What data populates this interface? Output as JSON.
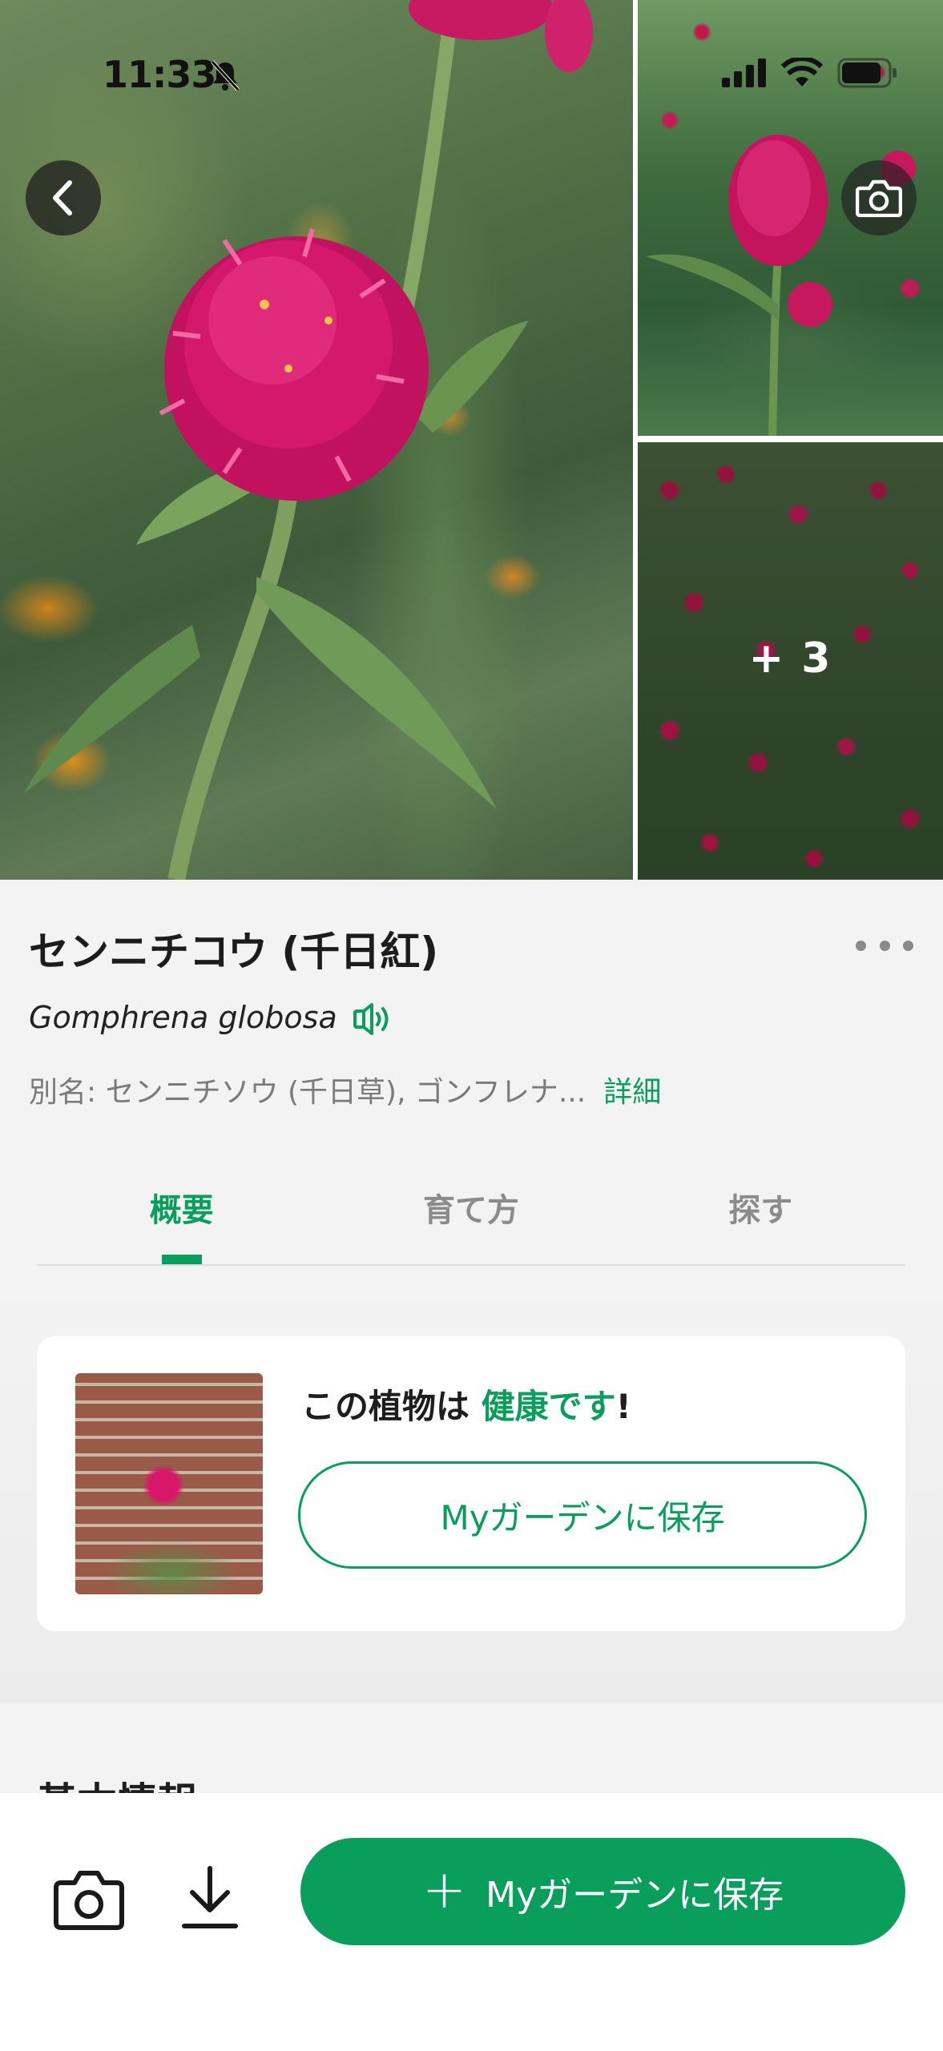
{
  "status_bar": {
    "time": "11:33",
    "icons": [
      "bell-slash-icon",
      "cellular-signal-icon",
      "wifi-icon",
      "battery-icon"
    ]
  },
  "gallery": {
    "more_photos": "+ 3"
  },
  "plant": {
    "name": "センニチコウ (千日紅)",
    "scientific_name": "Gomphrena globosa",
    "alias": "別名: センニチソウ (千日草), ゴンフレナ...",
    "alias_more": "詳細"
  },
  "tabs": [
    {
      "label": "概要",
      "active": true
    },
    {
      "label": "育て方",
      "active": false
    },
    {
      "label": "探す",
      "active": false
    }
  ],
  "health_card": {
    "prefix": "この植物は ",
    "status": "健康です",
    "suffix": "!",
    "button": "Myガーデンに保存"
  },
  "section_peek": "基本情報",
  "bottom_bar": {
    "save_button": "Myガーデンに保存"
  },
  "colors": {
    "accent": "#0a9e5c",
    "text": "#1c1c1c",
    "muted": "#7a7a7a"
  }
}
